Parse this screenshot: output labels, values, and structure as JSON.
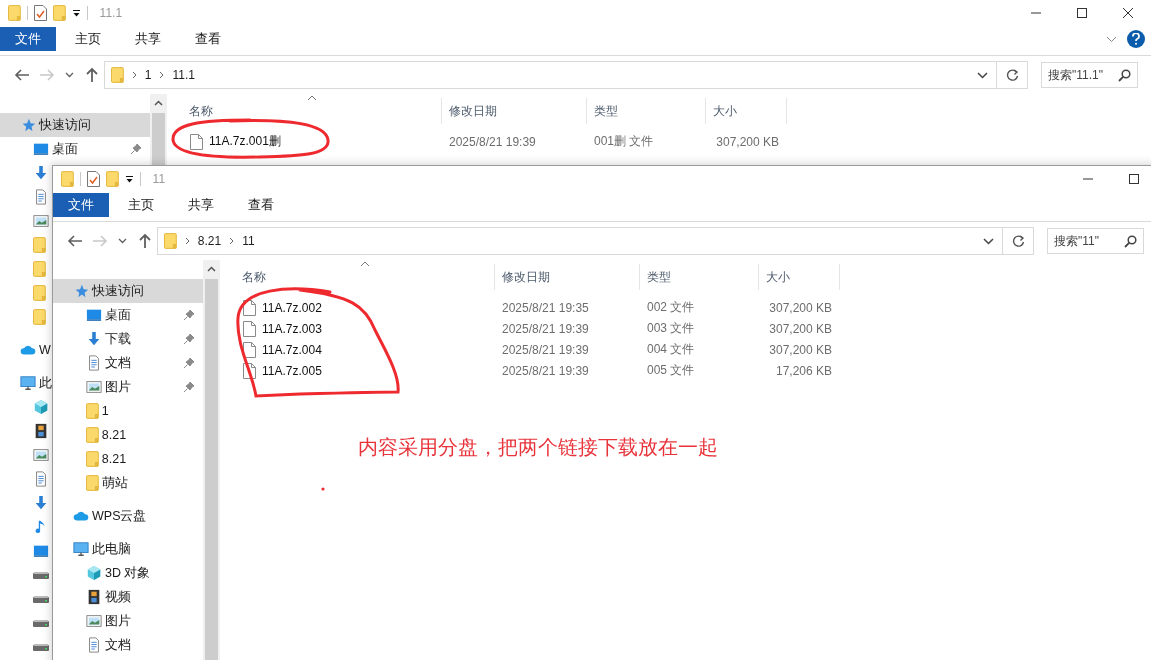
{
  "windows": [
    {
      "title": "11.1",
      "controls": [
        {
          "kind": "minimize"
        },
        {
          "kind": "maximize"
        },
        {
          "kind": "close"
        }
      ],
      "ribbon_help": true,
      "ribbon": [
        {
          "label": "文件",
          "kind": "file"
        },
        {
          "label": "主页",
          "kind": "tab"
        },
        {
          "label": "共享",
          "kind": "tab"
        },
        {
          "label": "查看",
          "kind": "tab"
        }
      ],
      "nav": [
        {
          "kind": "back",
          "disabled": false
        },
        {
          "kind": "forward",
          "disabled": true
        },
        {
          "kind": "recent",
          "disabled": false
        },
        {
          "kind": "up",
          "disabled": false
        }
      ],
      "breadcrumb": [
        "1",
        "11.1"
      ],
      "search": {
        "placeholder": "搜索\"11.1\""
      },
      "sidebar": [
        {
          "kind": "quick",
          "label": "快速访问",
          "selected": true,
          "children": [
            {
              "kind": "desktop",
              "label": "桌面",
              "pinned": true,
              "selected": false
            },
            {
              "kind": "download",
              "selected": false
            },
            {
              "kind": "document",
              "selected": false
            },
            {
              "kind": "pictures",
              "selected": false
            },
            {
              "kind": "folder",
              "selected": false
            },
            {
              "kind": "folder",
              "selected": false
            },
            {
              "kind": "folder",
              "selected": false
            },
            {
              "kind": "folder",
              "selected": false
            }
          ]
        },
        {
          "kind": "cloud",
          "label": "W",
          "selected": false
        },
        {
          "kind": "pc",
          "label": "此",
          "selected": false,
          "children": [
            {
              "kind": "cube",
              "selected": false
            },
            {
              "kind": "video",
              "selected": false
            },
            {
              "kind": "pictures",
              "selected": false
            },
            {
              "kind": "document",
              "selected": false
            },
            {
              "kind": "download",
              "selected": false
            },
            {
              "kind": "music",
              "selected": false
            },
            {
              "kind": "desktop",
              "selected": false
            },
            {
              "kind": "drive",
              "selected": false
            },
            {
              "kind": "drive",
              "selected": false
            },
            {
              "kind": "drive",
              "selected": false
            },
            {
              "kind": "drive",
              "selected": false
            }
          ]
        }
      ],
      "columns": [
        "名称",
        "修改日期",
        "类型",
        "大小"
      ],
      "files": [
        {
          "name": "11A.7z.001删",
          "date": "2025/8/21 19:39",
          "type": "001删 文件",
          "size": "307,200 KB"
        }
      ]
    },
    {
      "title": "11",
      "controls": [
        {
          "kind": "minimize"
        },
        {
          "kind": "maximize"
        }
      ],
      "ribbon": [
        {
          "label": "文件",
          "kind": "file"
        },
        {
          "label": "主页",
          "kind": "tab"
        },
        {
          "label": "共享",
          "kind": "tab"
        },
        {
          "label": "查看",
          "kind": "tab"
        }
      ],
      "nav": [
        {
          "kind": "back",
          "disabled": false
        },
        {
          "kind": "forward",
          "disabled": true
        },
        {
          "kind": "recent",
          "disabled": false
        },
        {
          "kind": "up",
          "disabled": false
        }
      ],
      "breadcrumb": [
        "8.21",
        "11"
      ],
      "search": {
        "placeholder": "搜索\"11\""
      },
      "sidebar": [
        {
          "kind": "quick",
          "label": "快速访问",
          "selected": true,
          "children": [
            {
              "kind": "desktop",
              "label": "桌面",
              "pinned": true,
              "selected": false
            },
            {
              "kind": "download",
              "label": "下载",
              "pinned": true,
              "selected": false
            },
            {
              "kind": "document",
              "label": "文档",
              "pinned": true,
              "selected": false
            },
            {
              "kind": "pictures",
              "label": "图片",
              "pinned": true,
              "selected": false
            },
            {
              "kind": "folder",
              "label": "1",
              "selected": false
            },
            {
              "kind": "folder",
              "label": "8.21",
              "selected": false
            },
            {
              "kind": "folder",
              "label": "8.21",
              "selected": false
            },
            {
              "kind": "folder",
              "label": "萌站",
              "selected": false
            }
          ]
        },
        {
          "kind": "cloud",
          "label": "WPS云盘",
          "selected": false
        },
        {
          "kind": "pc",
          "label": "此电脑",
          "selected": false,
          "children": [
            {
              "kind": "cube",
              "label": "3D 对象",
              "selected": false
            },
            {
              "kind": "video",
              "label": "视频",
              "selected": false
            },
            {
              "kind": "pictures",
              "label": "图片",
              "selected": false
            },
            {
              "kind": "document",
              "label": "文档",
              "selected": false
            }
          ]
        }
      ],
      "columns": [
        "名称",
        "修改日期",
        "类型",
        "大小"
      ],
      "files": [
        {
          "name": "11A.7z.002",
          "date": "2025/8/21 19:35",
          "type": "002 文件",
          "size": "307,200 KB"
        },
        {
          "name": "11A.7z.003",
          "date": "2025/8/21 19:39",
          "type": "003 文件",
          "size": "307,200 KB"
        },
        {
          "name": "11A.7z.004",
          "date": "2025/8/21 19:39",
          "type": "004 文件",
          "size": "307,200 KB"
        },
        {
          "name": "11A.7z.005",
          "date": "2025/8/21 19:39",
          "type": "005 文件",
          "size": "17,206 KB"
        }
      ]
    }
  ],
  "annotation": {
    "text": "内容采用分盘，把两个链接下载放在一起"
  }
}
